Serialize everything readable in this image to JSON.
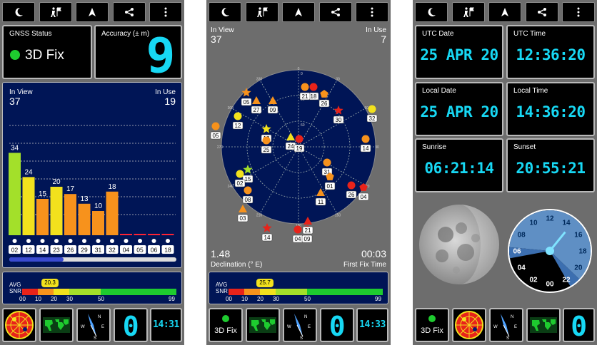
{
  "panel1": {
    "gnss_status_label": "GNSS Status",
    "fix_label": "3D Fix",
    "accuracy_label": "Accuracy (± m)",
    "accuracy_value": "9",
    "in_view_label": "In View",
    "in_view_value": "37",
    "in_use_label": "In Use",
    "in_use_value": "19",
    "bars": [
      {
        "prn": "02",
        "snr": 34,
        "label": "34",
        "color": "#a3e02a"
      },
      {
        "prn": "12",
        "snr": 24,
        "label": "24",
        "color": "#f2e11d"
      },
      {
        "prn": "14",
        "snr": 15,
        "label": "15",
        "color": "#f7921c"
      },
      {
        "prn": "23",
        "snr": 20,
        "label": "20",
        "color": "#f2e11d"
      },
      {
        "prn": "26",
        "snr": 17,
        "label": "17",
        "color": "#f7921c"
      },
      {
        "prn": "29",
        "snr": 13,
        "label": "13",
        "color": "#f7921c"
      },
      {
        "prn": "31",
        "snr": 10,
        "label": "10",
        "color": "#f7921c"
      },
      {
        "prn": "32",
        "snr": 18,
        "label": "18",
        "color": "#f7921c"
      },
      {
        "prn": "04",
        "snr": 0,
        "label": "",
        "color": "#f23"
      },
      {
        "prn": "05",
        "snr": 0,
        "label": "",
        "color": "#f23"
      },
      {
        "prn": "06",
        "snr": 0,
        "label": "",
        "color": "#f23"
      },
      {
        "prn": "18",
        "snr": 0,
        "label": "",
        "color": "#f23"
      }
    ],
    "avg_label": "AVG",
    "snr_label": "SNR",
    "avg_value": "20.3",
    "scale_ticks": [
      "00",
      "10",
      "20",
      "30",
      "50",
      "99"
    ],
    "clock": "14:31",
    "count_value": "0"
  },
  "panel2": {
    "in_view_label": "In View",
    "in_view_value": "37",
    "in_use_label": "In Use",
    "in_use_value": "7",
    "declination_value": "1.48",
    "declination_label": "Declination (° E)",
    "first_fix_value": "00:03",
    "first_fix_label": "First Fix Time",
    "avg_label": "AVG",
    "snr_label": "SNR",
    "avg_value": "25.7",
    "scale_ticks": [
      "00",
      "10",
      "20",
      "30",
      "50",
      "99"
    ],
    "fix_label": "3D Fix",
    "count_value": "0",
    "clock": "14:33",
    "sky_ring_labels": [
      "0",
      "30",
      "60"
    ],
    "sats": [
      {
        "prn": "18",
        "shape": "circle",
        "color": "#e8231a"
      },
      {
        "prn": "21",
        "shape": "circle",
        "color": "#f7921c"
      },
      {
        "prn": "05",
        "shape": "star",
        "color": "#f7921c"
      },
      {
        "prn": "27",
        "shape": "triangle",
        "color": "#f7921c"
      },
      {
        "prn": "09",
        "shape": "triangle",
        "color": "#f7921c"
      },
      {
        "prn": "26",
        "shape": "pentagon",
        "color": "#f7921c"
      },
      {
        "prn": "30",
        "shape": "star",
        "color": "#e8231a"
      },
      {
        "prn": "12",
        "shape": "circle",
        "color": "#f2e11d"
      },
      {
        "prn": "13",
        "shape": "star",
        "color": "#f2e11d"
      },
      {
        "prn": "25",
        "shape": "circle",
        "color": "#f7921c"
      },
      {
        "prn": "05",
        "shape": "circle",
        "color": "#f7921c"
      },
      {
        "prn": "32",
        "shape": "circle",
        "color": "#f2e11d"
      },
      {
        "prn": "14",
        "shape": "circle",
        "color": "#f7921c"
      },
      {
        "prn": "24",
        "shape": "triangle",
        "color": "#f2e11d"
      },
      {
        "prn": "19",
        "shape": "circle",
        "color": "#e8231a"
      },
      {
        "prn": "31",
        "shape": "circle",
        "color": "#f7921c"
      },
      {
        "prn": "15",
        "shape": "star",
        "color": "#a3e02a"
      },
      {
        "prn": "02",
        "shape": "circle",
        "color": "#f2e11d"
      },
      {
        "prn": "01",
        "shape": "pentagon",
        "color": "#f7921c"
      },
      {
        "prn": "26",
        "shape": "circle",
        "color": "#e8231a"
      },
      {
        "prn": "04",
        "shape": "pentagon",
        "color": "#e8231a"
      },
      {
        "prn": "08",
        "shape": "circle",
        "color": "#f7921c"
      },
      {
        "prn": "11",
        "shape": "triangle",
        "color": "#f7921c"
      },
      {
        "prn": "03",
        "shape": "triangle",
        "color": "#f7921c"
      },
      {
        "prn": "14",
        "shape": "star",
        "color": "#e8231a"
      },
      {
        "prn": "04",
        "shape": "circle",
        "color": "#e8231a"
      },
      {
        "prn": "09",
        "shape": "circle",
        "color": "#e8231a"
      },
      {
        "prn": "21",
        "shape": "triangle",
        "color": "#e8231a"
      }
    ]
  },
  "panel3": {
    "utc_date_label": "UTC Date",
    "utc_date_value": "25 APR 20",
    "utc_time_label": "UTC Time",
    "utc_time_value": "12:36:20",
    "local_date_label": "Local Date",
    "local_date_value": "25 APR 20",
    "local_time_label": "Local Time",
    "local_time_value": "14:36:20",
    "sunrise_label": "Sunrise",
    "sunrise_value": "06:21:14",
    "sunset_label": "Sunset",
    "sunset_value": "20:55:21",
    "fix_label": "3D Fix",
    "count_value": "0",
    "clock_numbers": [
      "12",
      "14",
      "16",
      "18",
      "20",
      "22",
      "00",
      "02",
      "04",
      "06",
      "08",
      "10"
    ]
  },
  "toolbar_icons": [
    "night-mode-icon",
    "map-icon",
    "navigation-icon",
    "share-icon",
    "more-icon"
  ],
  "compass_letters": [
    "N",
    "E",
    "S",
    "W"
  ],
  "colors": {
    "lcd": "#17d8f4",
    "fix_dot": "#1ecb2f",
    "bar_dark": "#0d1a6b"
  }
}
